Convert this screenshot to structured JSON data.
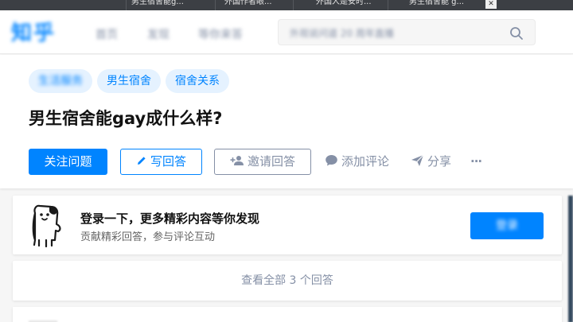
{
  "browser_tabs": [
    {
      "label": "男生宿舍能g..."
    },
    {
      "label": "外国作者眼..."
    },
    {
      "label": "外国人是安时..."
    },
    {
      "label": "男生宿舍能 g..."
    }
  ],
  "header": {
    "logo": "知乎",
    "nav": [
      "首页",
      "发现",
      "等你来答"
    ],
    "search_placeholder": "外观说问道 20 周年直播"
  },
  "question": {
    "topics": [
      "生活服务",
      "男生宿舍",
      "宿舍关系"
    ],
    "title": "男生宿舍能gay成什么样?",
    "follow_label": "关注问题",
    "write_label": "写回答",
    "invite_label": "邀请回答",
    "comment_label": "添加评论",
    "share_label": "分享",
    "more_label": "···"
  },
  "login_prompt": {
    "title": "登录一下，更多精彩内容等你发现",
    "subtitle": "贡献精彩回答，参与评论互动",
    "button_label": "登录"
  },
  "view_all": {
    "label": "查看全部 3 个回答"
  },
  "colors": {
    "brand": "#0084ff",
    "muted": "#8590a6",
    "topic_bg": "#e5f2ff"
  }
}
